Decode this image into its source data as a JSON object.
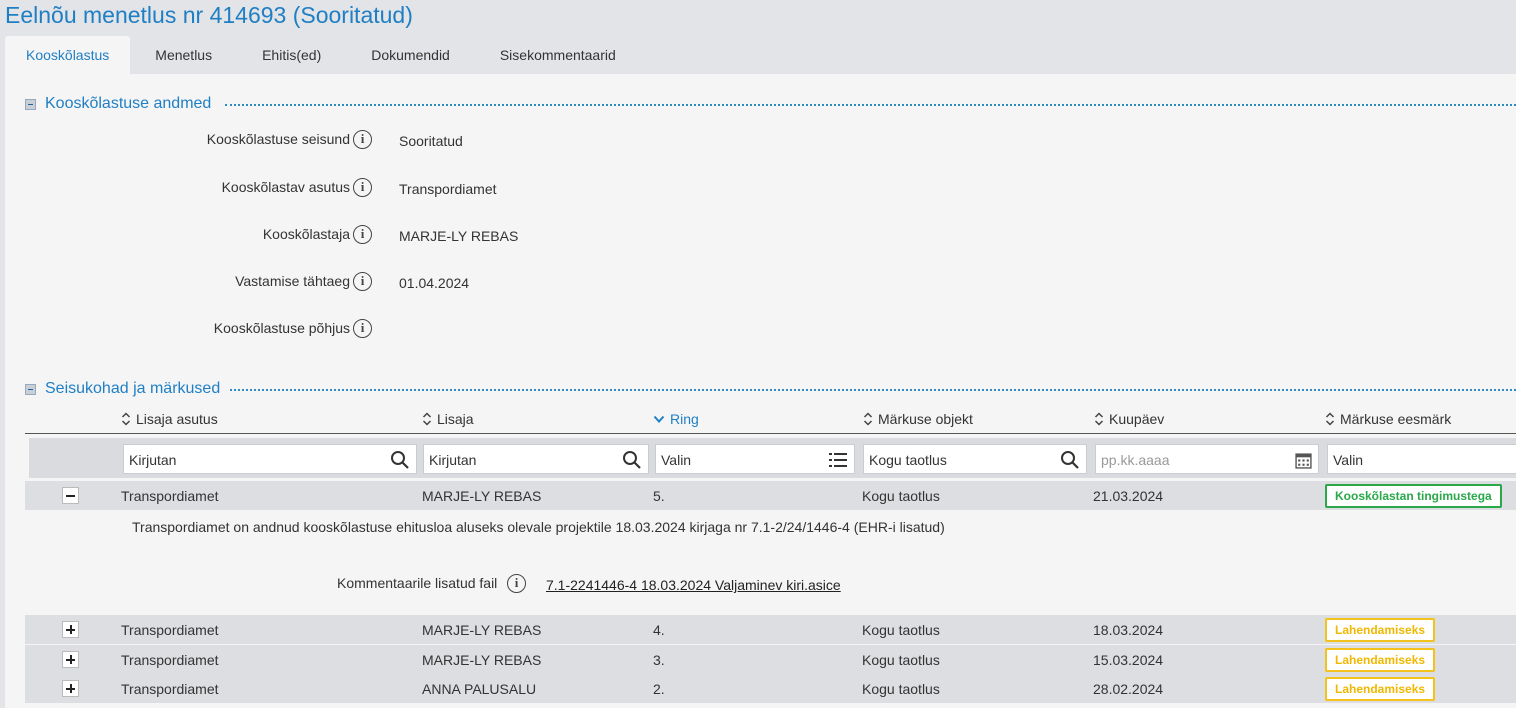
{
  "page": {
    "title": "Eelnõu menetlus nr 414693 (Sooritatud)"
  },
  "tabs": [
    {
      "label": "Kooskõlastus",
      "active": true
    },
    {
      "label": "Menetlus",
      "active": false
    },
    {
      "label": "Ehitis(ed)",
      "active": false
    },
    {
      "label": "Dokumendid",
      "active": false
    },
    {
      "label": "Sisekommentaarid",
      "active": false
    }
  ],
  "section1": {
    "title": "Kooskõlastuse andmed",
    "fields": [
      {
        "label": "Kooskõlastuse seisund",
        "value": "Sooritatud"
      },
      {
        "label": "Kooskõlastav asutus",
        "value": "Transpordiamet"
      },
      {
        "label": "Kooskõlastaja",
        "value": "MARJE-LY REBAS"
      },
      {
        "label": "Vastamise tähtaeg",
        "value": "01.04.2024"
      },
      {
        "label": "Kooskõlastuse põhjus",
        "value": ""
      }
    ]
  },
  "section2": {
    "title": "Seisukohad ja märkused",
    "columns": [
      {
        "label": "Lisaja asutus"
      },
      {
        "label": "Lisaja"
      },
      {
        "label": "Ring"
      },
      {
        "label": "Märkuse objekt"
      },
      {
        "label": "Kuupäev"
      },
      {
        "label": "Märkuse eesmärk"
      }
    ],
    "filters": [
      {
        "value": "Kirjutan",
        "icon": "search-icon"
      },
      {
        "value": "Kirjutan",
        "icon": "search-icon"
      },
      {
        "value": "Valin",
        "icon": "list-icon"
      },
      {
        "value": "Kogu taotlus",
        "icon": "search-icon"
      },
      {
        "placeholder": "pp.kk.aaaa",
        "icon": "calendar-icon"
      },
      {
        "value": "Valin",
        "icon": ""
      }
    ],
    "rows": [
      {
        "asutus": "Transpordiamet",
        "lisaja": "MARJE-LY REBAS",
        "ring": "5.",
        "objekt": "Kogu taotlus",
        "kuupaev": "21.03.2024",
        "eesmark": "Kooskõlastan tingimustega",
        "expanded": true
      },
      {
        "asutus": "Transpordiamet",
        "lisaja": "MARJE-LY REBAS",
        "ring": "4.",
        "objekt": "Kogu taotlus",
        "kuupaev": "18.03.2024",
        "eesmark": "Lahendamiseks",
        "expanded": false
      },
      {
        "asutus": "Transpordiamet",
        "lisaja": "MARJE-LY REBAS",
        "ring": "3.",
        "objekt": "Kogu taotlus",
        "kuupaev": "15.03.2024",
        "eesmark": "Lahendamiseks",
        "expanded": false
      },
      {
        "asutus": "Transpordiamet",
        "lisaja": "ANNA PALUSALU",
        "ring": "2.",
        "objekt": "Kogu taotlus",
        "kuupaev": "28.02.2024",
        "eesmark": "Lahendamiseks",
        "expanded": false
      }
    ],
    "detail": {
      "text": "Transpordiamet on andnud kooskõlastuse ehitusloa aluseks olevale projektile 18.03.2024 kirjaga nr 7.1-2/24/1446-4 (EHR-i lisatud)",
      "file_label": "Kommentaarile lisatud fail",
      "file_name": "7.1-2241446-4 18.03.2024 Valjaminev kiri.asice"
    }
  },
  "colors": {
    "accent": "#1f7fc4",
    "green": "#2aa84a",
    "yellow": "#f4c21d"
  }
}
